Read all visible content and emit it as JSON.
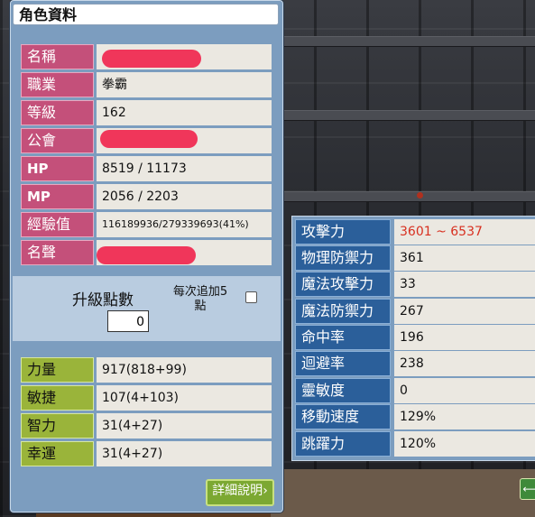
{
  "window": {
    "title": "角色資料"
  },
  "info": [
    {
      "label": "名稱",
      "value": ""
    },
    {
      "label": "職業",
      "value": "拳霸"
    },
    {
      "label": "等級",
      "value": "162"
    },
    {
      "label": "公會",
      "value": ""
    },
    {
      "label": "HP",
      "value": "8519 / 11173"
    },
    {
      "label": "MP",
      "value": "2056 / 2203"
    },
    {
      "label": "經驗值",
      "value": "116189936/279339693(41%)"
    },
    {
      "label": "名聲",
      "value": ""
    }
  ],
  "ap": {
    "label": "升級點數",
    "value": "0",
    "auto_label_line1": "每次追加5",
    "auto_label_line2": "點",
    "auto_checked": false
  },
  "attributes": [
    {
      "label": "力量",
      "value": "917(818+99)"
    },
    {
      "label": "敏捷",
      "value": "107(4+103)"
    },
    {
      "label": "智力",
      "value": "31(4+27)"
    },
    {
      "label": "幸運",
      "value": "31(4+27)"
    }
  ],
  "detail_button": {
    "label": "詳細說明"
  },
  "stats": [
    {
      "label": "攻擊力",
      "value": "3601 ~ 6537",
      "highlight": true
    },
    {
      "label": "物理防禦力",
      "value": "361"
    },
    {
      "label": "魔法攻擊力",
      "value": "33"
    },
    {
      "label": "魔法防禦力",
      "value": "267"
    },
    {
      "label": "命中率",
      "value": "196"
    },
    {
      "label": "迴避率",
      "value": "238"
    },
    {
      "label": "靈敏度",
      "value": "0"
    },
    {
      "label": "移動速度",
      "value": "129%"
    },
    {
      "label": "跳躍力",
      "value": "120%"
    }
  ],
  "colors": {
    "panel": "#7c9dbf",
    "info_label": "#c4507a",
    "attr_label": "#9ab43a",
    "stat_label": "#2b5f9a",
    "attack_value": "#d83020"
  }
}
